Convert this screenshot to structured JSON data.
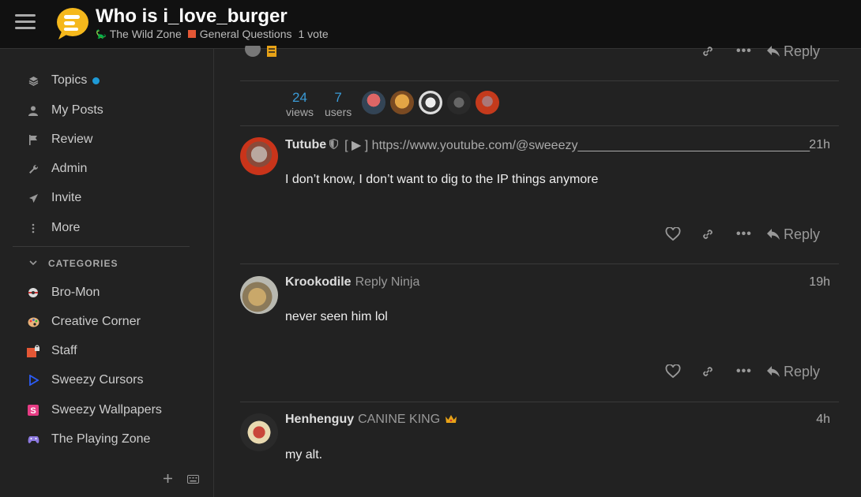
{
  "header": {
    "title": "Who is i_love_burger",
    "category1": "The Wild Zone",
    "category2": "General Questions",
    "votes": "1 vote"
  },
  "sidebar": {
    "nav": [
      {
        "label": "Topics",
        "icon": "layers-icon"
      },
      {
        "label": "My Posts",
        "icon": "user-icon"
      },
      {
        "label": "Review",
        "icon": "flag-icon"
      },
      {
        "label": "Admin",
        "icon": "wrench-icon"
      },
      {
        "label": "Invite",
        "icon": "paper-plane-icon"
      },
      {
        "label": "More",
        "icon": "vertical-dots-icon"
      }
    ],
    "categories_heading": "CATEGORIES",
    "categories": [
      {
        "label": "Bro-Mon",
        "icon": "bro-mon-icon"
      },
      {
        "label": "Creative Corner",
        "icon": "palette-icon"
      },
      {
        "label": "Staff",
        "icon": "lock-square-icon",
        "color": "#e45735"
      },
      {
        "label": "Sweezy Cursors",
        "icon": "cursor-triangle-icon",
        "color": "#2c5cf5"
      },
      {
        "label": "Sweezy Wallpapers",
        "icon": "s-badge-icon",
        "color": "#e63c84"
      },
      {
        "label": "The Playing Zone",
        "icon": "gamepad-icon"
      }
    ]
  },
  "topic_map": {
    "views_count": "24",
    "views_label": "views",
    "users_count": "7",
    "users_label": "users"
  },
  "actions": {
    "reply_label": "Reply",
    "more_label": "•••"
  },
  "posts": [
    {
      "username": "Tutube",
      "bio": "[ ▶ ] https://www.youtube.com/@sweeezy_________________________________",
      "date": "21h",
      "body": "I don’t know, I don’t want to dig to the IP things anymore"
    },
    {
      "username": "Krookodile",
      "title": "Reply Ninja",
      "date": "19h",
      "body": "never seen him lol"
    },
    {
      "username": "Henhenguy",
      "title": "CANINE KING",
      "date": "4h",
      "body": "my alt."
    }
  ],
  "colors": {
    "accent": "#3a9ad6",
    "header_bg": "#111111",
    "page_bg": "#222222"
  }
}
